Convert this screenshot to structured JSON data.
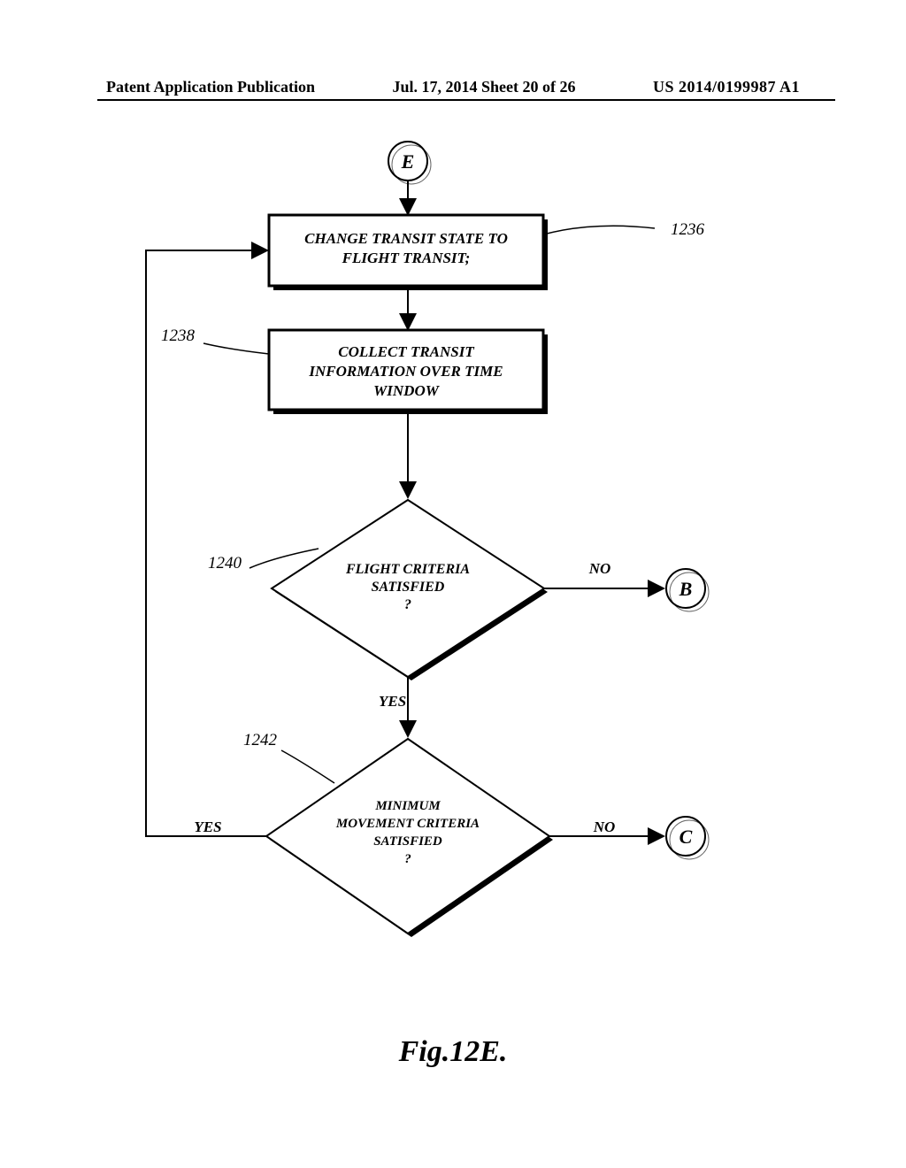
{
  "header": {
    "left": "Patent Application Publication",
    "center": "Jul. 17, 2014  Sheet 20 of 26",
    "right": "US 2014/0199987 A1"
  },
  "connectors": {
    "e": "E",
    "b": "B",
    "c": "C"
  },
  "refs": {
    "r1236": "1236",
    "r1238": "1238",
    "r1240": "1240",
    "r1242": "1242"
  },
  "boxes": {
    "box1236_l1": "CHANGE TRANSIT STATE TO",
    "box1236_l2": "FLIGHT TRANSIT;",
    "box1238_l1": "COLLECT TRANSIT",
    "box1238_l2": "INFORMATION OVER TIME",
    "box1238_l3": "WINDOW"
  },
  "decisions": {
    "d1240_l1": "FLIGHT CRITERIA",
    "d1240_l2": "SATISFIED",
    "d1240_l3": "?",
    "d1242_l1": "MINIMUM",
    "d1242_l2": "MOVEMENT CRITERIA",
    "d1242_l3": "SATISFIED",
    "d1242_l4": "?"
  },
  "labels": {
    "yes": "YES",
    "no": "NO"
  },
  "figure_caption": "Fig.12E."
}
